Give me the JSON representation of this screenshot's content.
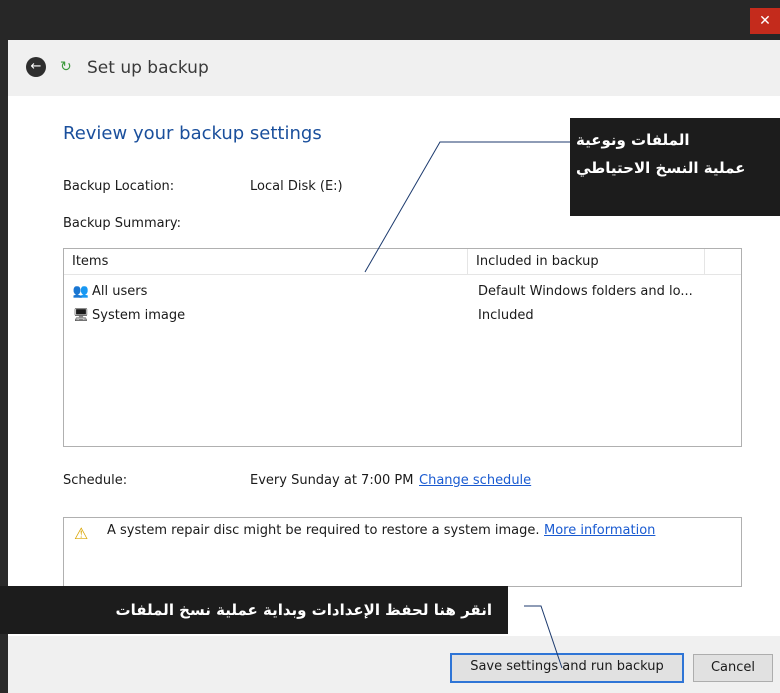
{
  "window": {
    "close_glyph": "✕"
  },
  "header": {
    "title": "Set up backup",
    "back_glyph": "←",
    "app_icon_glyph": "↻"
  },
  "main": {
    "heading": "Review your backup settings",
    "backup_location_label": "Backup Location:",
    "backup_location_value": "Local Disk (E:)",
    "backup_summary_label": "Backup Summary:",
    "table": {
      "columns": [
        "Items",
        "Included in backup"
      ],
      "rows": [
        {
          "icon": "users-icon",
          "glyph": "👥",
          "item": "All users",
          "included": "Default Windows folders and lo..."
        },
        {
          "icon": "system-image-icon",
          "glyph": "🖥",
          "item": "System image",
          "included": "Included"
        }
      ]
    },
    "schedule_label": "Schedule:",
    "schedule_value": "Every Sunday at 7:00 PM",
    "change_schedule_link": "Change schedule",
    "warning": {
      "glyph": "⚠",
      "text": "A system repair disc might be required to restore a system image.",
      "link": "More information"
    }
  },
  "footer": {
    "save_button": "Save settings and run backup",
    "cancel_button": "Cancel"
  },
  "callouts": {
    "top_line1": "الملفات ونوعية",
    "top_line2": "عملية النسخ الاحتياطي",
    "bottom": "انقر هنا لحفظ الإعدادات وبداية عملية نسخ الملفات"
  },
  "colors": {
    "heading": "#1a4f9c",
    "link": "#1a5bd1",
    "close": "#c42b1c",
    "callout_bg": "#1c1c1c"
  }
}
